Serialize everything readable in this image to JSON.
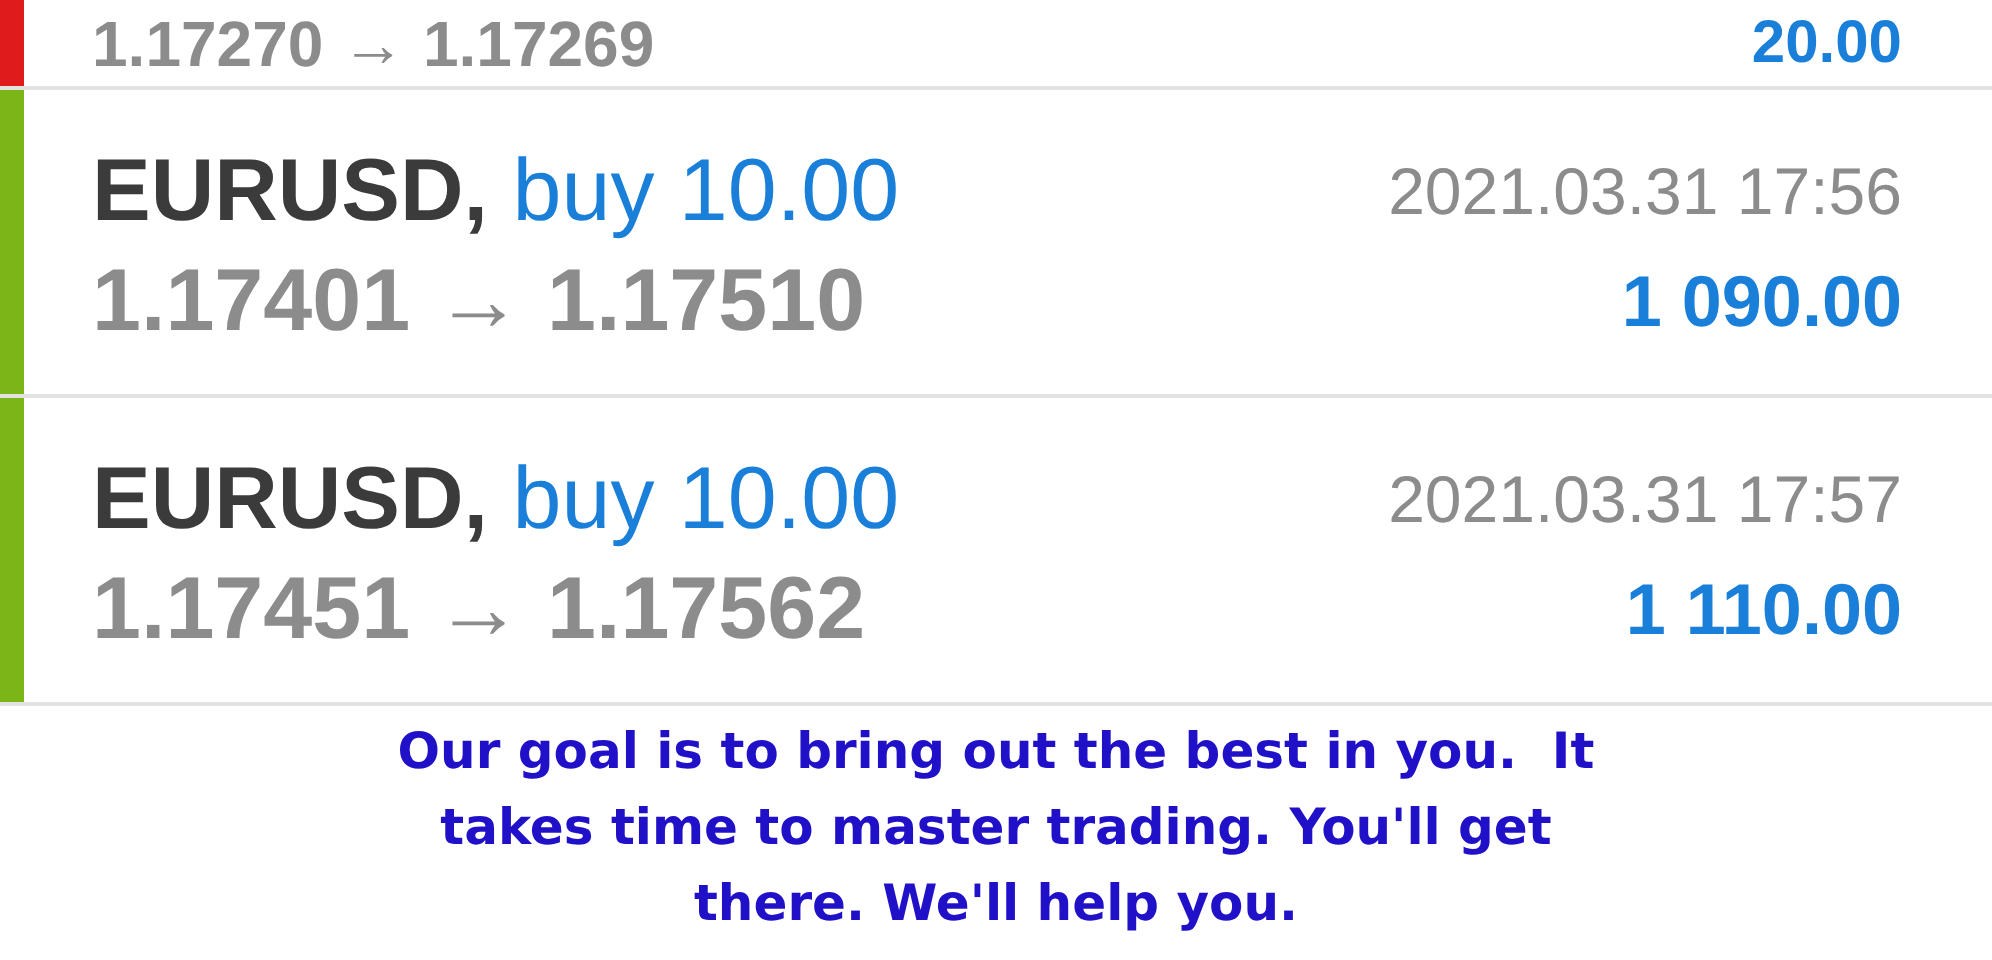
{
  "trades": [
    {
      "kind": "partial",
      "prices": "1.17270 → 1.17269",
      "profit": "20.00",
      "color": "#e01b1b"
    },
    {
      "kind": "full",
      "symbol": "EURUSD,",
      "side": "buy 10.00",
      "prices": "1.17401 → 1.17510",
      "time": "2021.03.31 17:56",
      "profit": "1 090.00",
      "color": "#7cb518"
    },
    {
      "kind": "full",
      "symbol": "EURUSD,",
      "side": "buy 10.00",
      "prices": "1.17451 → 1.17562",
      "time": "2021.03.31 17:57",
      "profit": "1 110.00",
      "color": "#7cb518"
    }
  ],
  "message": "Our goal is to bring out the best in you.  It takes time to master trading. You'll get there. We'll help you."
}
